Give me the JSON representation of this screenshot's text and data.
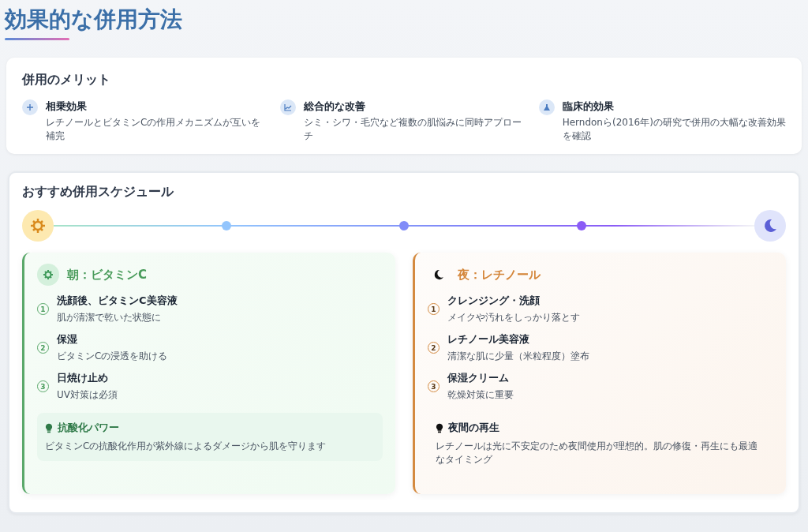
{
  "page_title": "効果的な併用方法",
  "merits": {
    "title": "併用のメリット",
    "items": [
      {
        "kind": "plus",
        "title": "相乗効果",
        "text": "レチノールとビタミンCの作用メカニズムが互いを補完"
      },
      {
        "kind": "chart",
        "title": "総合的な改善",
        "text": "シミ・シワ・毛穴など複数の肌悩みに同時アプローチ"
      },
      {
        "kind": "flask",
        "title": "臨床的効果",
        "text": "Herndonら(2016年)の研究で併用の大幅な改善効果を確認"
      }
    ]
  },
  "schedule": {
    "title": "おすすめ併用スケジュール",
    "timeline_dots": [
      {
        "color": "#93c5fd"
      },
      {
        "color": "#818cf8"
      },
      {
        "color": "#8b5cf6"
      }
    ],
    "routines": [
      {
        "kind": "morning",
        "title": "朝：ビタミンC",
        "steps": [
          {
            "number": "1",
            "title": "洗顔後、ビタミンC美容液",
            "text": "肌が清潔で乾いた状態に"
          },
          {
            "number": "2",
            "title": "保湿",
            "text": "ビタミンCの浸透を助ける"
          },
          {
            "number": "3",
            "title": "日焼け止め",
            "text": "UV対策は必須"
          }
        ],
        "tip": {
          "title": "抗酸化パワー",
          "text": "ビタミンCの抗酸化作用が紫外線によるダメージから肌を守ります"
        }
      },
      {
        "kind": "night",
        "title": "夜：レチノール",
        "steps": [
          {
            "number": "1",
            "title": "クレンジング・洗顔",
            "text": "メイクや汚れをしっかり落とす"
          },
          {
            "number": "2",
            "title": "レチノール美容液",
            "text": "清潔な肌に少量（米粒程度）塗布"
          },
          {
            "number": "3",
            "title": "保湿クリーム",
            "text": "乾燥対策に重要"
          }
        ],
        "tip": {
          "title": "夜間の再生",
          "text": "レチノールは光に不安定のため夜間使用が理想的。肌の修復・再生にも最適なタイミング"
        }
      }
    ]
  }
}
